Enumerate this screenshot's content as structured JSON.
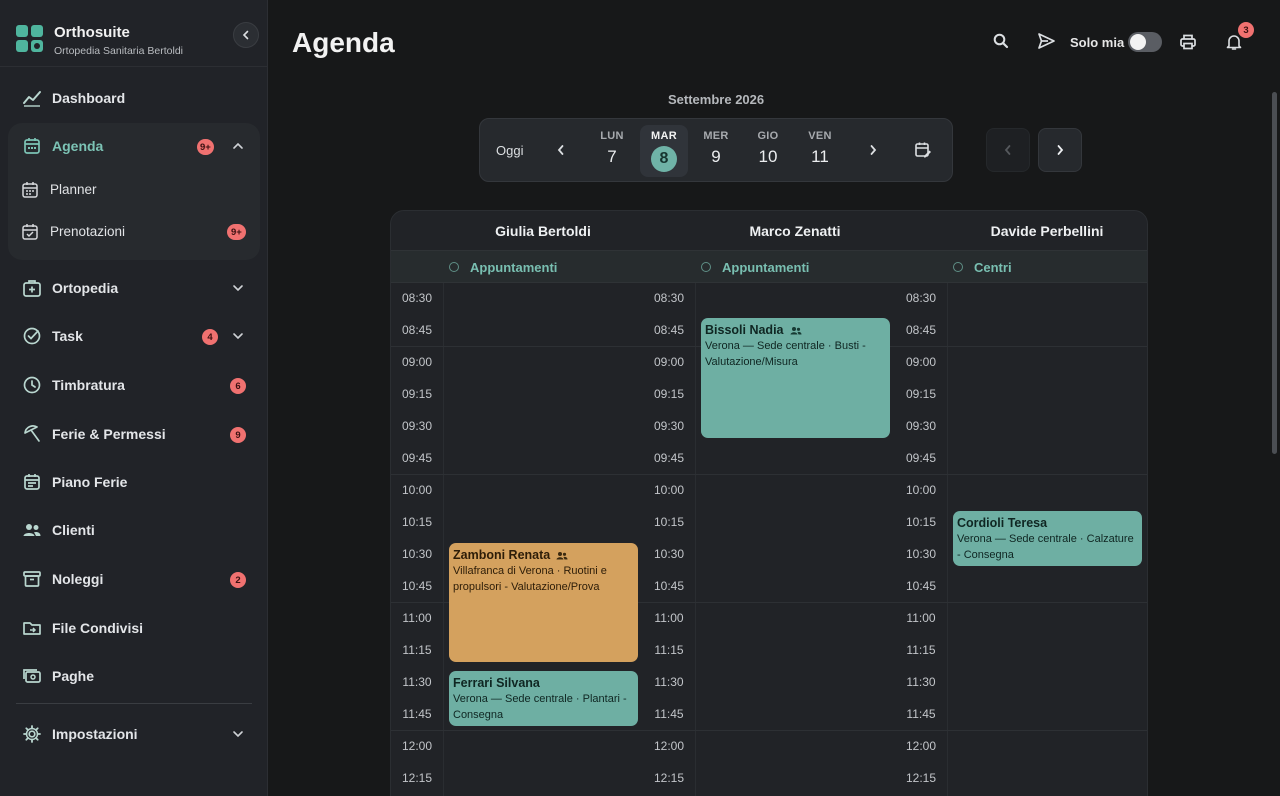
{
  "brand": {
    "name": "Orthosuite",
    "subtitle": "Ortopedia Sanitaria Bertoldi"
  },
  "sidebar": {
    "items": [
      {
        "label": "Dashboard"
      },
      {
        "label": "Agenda",
        "badge": "9+"
      },
      {
        "label": "Ortopedia"
      },
      {
        "label": "Task",
        "badge": "4"
      },
      {
        "label": "Timbratura",
        "badge": "6"
      },
      {
        "label": "Ferie & Permessi",
        "badge": "9"
      },
      {
        "label": "Piano Ferie"
      },
      {
        "label": "Clienti"
      },
      {
        "label": "Noleggi",
        "badge": "2"
      },
      {
        "label": "File Condivisi"
      },
      {
        "label": "Paghe"
      },
      {
        "label": "Impostazioni"
      }
    ],
    "agenda_sub": [
      {
        "label": "Planner"
      },
      {
        "label": "Prenotazioni",
        "badge": "9+"
      }
    ]
  },
  "header": {
    "title": "Agenda",
    "solo_mia_label": "Solo mia",
    "solo_mia_on": false,
    "notifications": "3"
  },
  "datebar": {
    "month": "Settembre 2026",
    "today_label": "Oggi",
    "days": [
      {
        "name": "LUN",
        "num": "7"
      },
      {
        "name": "MAR",
        "num": "8"
      },
      {
        "name": "MER",
        "num": "9"
      },
      {
        "name": "GIO",
        "num": "10"
      },
      {
        "name": "VEN",
        "num": "11"
      }
    ],
    "active_index": 1
  },
  "columns": [
    {
      "name": "Giulia Bertoldi",
      "category": "Appuntamenti"
    },
    {
      "name": "Marco Zenatti",
      "category": "Appuntamenti"
    },
    {
      "name": "Davide Perbellini",
      "category": "Centri"
    }
  ],
  "times": [
    "08:30",
    "08:45",
    "09:00",
    "09:15",
    "09:30",
    "09:45",
    "10:00",
    "10:15",
    "10:30",
    "10:45",
    "11:00",
    "11:15",
    "11:30",
    "11:45",
    "12:00",
    "12:15"
  ],
  "events": [
    {
      "name": "Bissoli Nadia",
      "group_icon": true,
      "detail": "Verona — Sede centrale · Busti - Valutazione/Misura",
      "color": "#6eafa3"
    },
    {
      "name": "Zamboni Renata",
      "group_icon": true,
      "detail": "Villafranca di Verona · Ruotini e propulsori - Valutazione/Prova",
      "color": "#d4a15e"
    },
    {
      "name": "Ferrari Silvana",
      "group_icon": false,
      "detail": "Verona — Sede centrale · Plantari - Consegna",
      "color": "#6eafa3"
    },
    {
      "name": "Cordioli Teresa",
      "group_icon": false,
      "detail": "Verona — Sede centrale · Calzature - Consegna",
      "color": "#6eafa3"
    }
  ]
}
